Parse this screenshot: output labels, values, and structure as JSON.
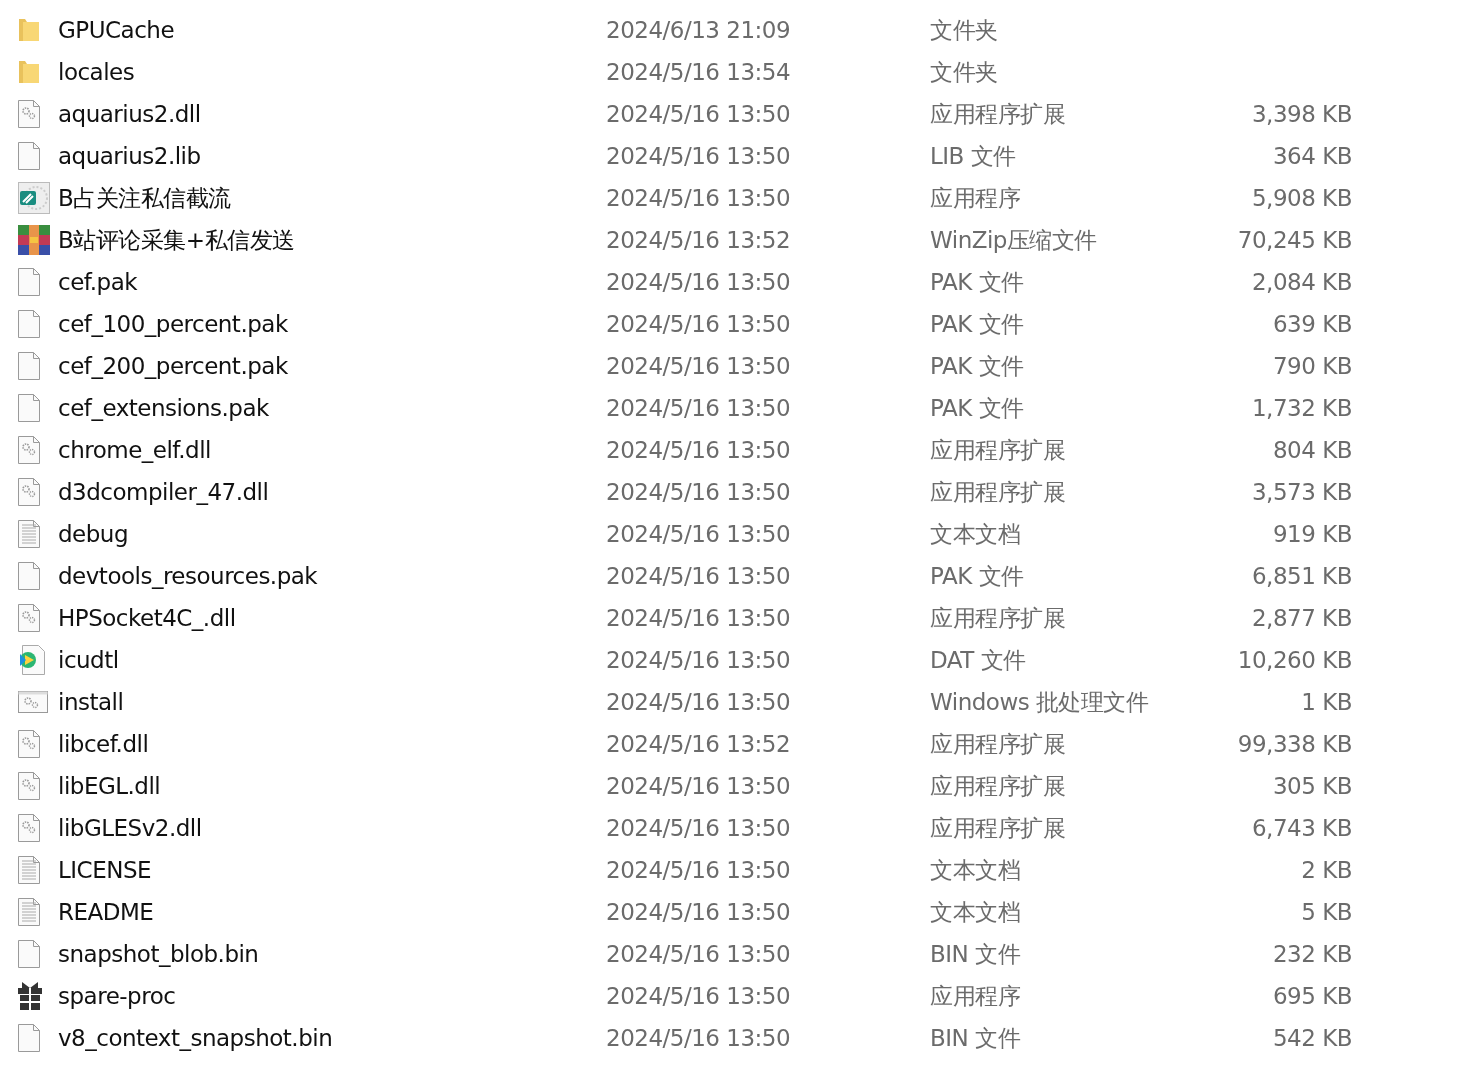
{
  "files": [
    {
      "kind": "folder",
      "name": "GPUCache",
      "date": "2024/6/13 21:09",
      "type": "文件夹"
    },
    {
      "kind": "folder",
      "name": "locales",
      "date": "2024/5/16 13:54",
      "type": "文件夹"
    },
    {
      "kind": "dll",
      "name": "aquarius2.dll",
      "date": "2024/5/16 13:50",
      "type": "应用程序扩展",
      "size": "3,398 KB"
    },
    {
      "kind": "blank",
      "name": "aquarius2.lib",
      "date": "2024/5/16 13:50",
      "type": "LIB 文件",
      "size": "364 KB"
    },
    {
      "kind": "app",
      "name": "B占关注私信截流",
      "date": "2024/5/16 13:50",
      "type": "应用程序",
      "size": "5,908 KB"
    },
    {
      "kind": "archive",
      "name": "B站评论采集+私信发送",
      "date": "2024/5/16 13:52",
      "type": "WinZip压缩文件",
      "size": "70,245 KB"
    },
    {
      "kind": "blank",
      "name": "cef.pak",
      "date": "2024/5/16 13:50",
      "type": "PAK 文件",
      "size": "2,084 KB"
    },
    {
      "kind": "blank",
      "name": "cef_100_percent.pak",
      "date": "2024/5/16 13:50",
      "type": "PAK 文件",
      "size": "639 KB"
    },
    {
      "kind": "blank",
      "name": "cef_200_percent.pak",
      "date": "2024/5/16 13:50",
      "type": "PAK 文件",
      "size": "790 KB"
    },
    {
      "kind": "blank",
      "name": "cef_extensions.pak",
      "date": "2024/5/16 13:50",
      "type": "PAK 文件",
      "size": "1,732 KB"
    },
    {
      "kind": "dll",
      "name": "chrome_elf.dll",
      "date": "2024/5/16 13:50",
      "type": "应用程序扩展",
      "size": "804 KB"
    },
    {
      "kind": "dll",
      "name": "d3dcompiler_47.dll",
      "date": "2024/5/16 13:50",
      "type": "应用程序扩展",
      "size": "3,573 KB"
    },
    {
      "kind": "text",
      "name": "debug",
      "date": "2024/5/16 13:50",
      "type": "文本文档",
      "size": "919 KB"
    },
    {
      "kind": "blank",
      "name": "devtools_resources.pak",
      "date": "2024/5/16 13:50",
      "type": "PAK 文件",
      "size": "6,851 KB"
    },
    {
      "kind": "dll",
      "name": "HPSocket4C_.dll",
      "date": "2024/5/16 13:50",
      "type": "应用程序扩展",
      "size": "2,877 KB"
    },
    {
      "kind": "video",
      "name": "icudtl",
      "date": "2024/5/16 13:50",
      "type": "DAT 文件",
      "size": "10,260 KB"
    },
    {
      "kind": "batch",
      "name": "install",
      "date": "2024/5/16 13:50",
      "type": "Windows 批处理文件",
      "size": "1 KB"
    },
    {
      "kind": "dll",
      "name": "libcef.dll",
      "date": "2024/5/16 13:52",
      "type": "应用程序扩展",
      "size": "99,338 KB"
    },
    {
      "kind": "dll",
      "name": "libEGL.dll",
      "date": "2024/5/16 13:50",
      "type": "应用程序扩展",
      "size": "305 KB"
    },
    {
      "kind": "dll",
      "name": "libGLESv2.dll",
      "date": "2024/5/16 13:50",
      "type": "应用程序扩展",
      "size": "6,743 KB"
    },
    {
      "kind": "text",
      "name": "LICENSE",
      "date": "2024/5/16 13:50",
      "type": "文本文档",
      "size": "2 KB"
    },
    {
      "kind": "text",
      "name": "README",
      "date": "2024/5/16 13:50",
      "type": "文本文档",
      "size": "5 KB"
    },
    {
      "kind": "blank",
      "name": "snapshot_blob.bin",
      "date": "2024/5/16 13:50",
      "type": "BIN 文件",
      "size": "232 KB"
    },
    {
      "kind": "gift",
      "name": "spare-proc",
      "date": "2024/5/16 13:50",
      "type": "应用程序",
      "size": "695 KB"
    },
    {
      "kind": "blank",
      "name": "v8_context_snapshot.bin",
      "date": "2024/5/16 13:50",
      "type": "BIN 文件",
      "size": "542 KB"
    }
  ]
}
